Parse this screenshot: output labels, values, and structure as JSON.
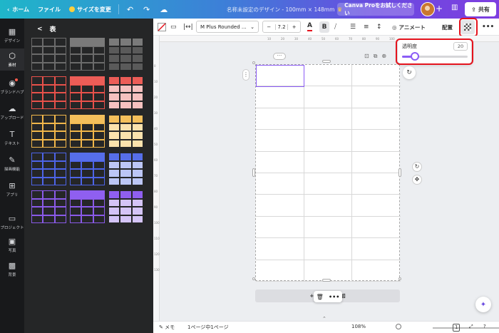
{
  "topbar": {
    "home": "ホーム",
    "file": "ファイル",
    "resize": "サイズを変更",
    "title": "名称未設定のデザイン - 100mm × 148mm",
    "pro": "Canva Proをお試しください",
    "share": "共有"
  },
  "rail": [
    {
      "label": "デザイン",
      "icon": "▦"
    },
    {
      "label": "素材",
      "icon": "⬡"
    },
    {
      "label": "ブランドハブ",
      "icon": "◉"
    },
    {
      "label": "アップロード",
      "icon": "☁"
    },
    {
      "label": "テキスト",
      "icon": "T"
    },
    {
      "label": "描画機能",
      "icon": "✎"
    },
    {
      "label": "アプリ",
      "icon": "⊞"
    },
    {
      "label": "プロジェクト",
      "icon": "▭"
    },
    {
      "label": "写真",
      "icon": "▣"
    },
    {
      "label": "背景",
      "icon": "▩"
    }
  ],
  "panel": {
    "back": "<",
    "title": "表"
  },
  "tile_colors": [
    {
      "border": "#6b6b6b",
      "header": "#7a7a7a",
      "light": "#5a5a5a"
    },
    {
      "border": "#e8514a",
      "header": "#ec5d57",
      "light": "#f6c1bf"
    },
    {
      "border": "#f2b74a",
      "header": "#f4bf5b",
      "light": "#fbe2ad"
    },
    {
      "border": "#4d64e8",
      "header": "#566ee9",
      "light": "#bcc6f6"
    },
    {
      "border": "#8a5ae8",
      "header": "#8f5ff0",
      "light": "#d4c4f7"
    }
  ],
  "toolbar": {
    "font": "M Plus Rounded ...",
    "font_size": "7.2",
    "minus": "−",
    "plus": "+",
    "bold": "B",
    "animate": "アニメート",
    "position": "配置",
    "more": "•••"
  },
  "transparency": {
    "label": "透明度",
    "value": "20",
    "level": 0.2
  },
  "canvas": {
    "add_page": "+ ページを追加"
  },
  "ruler": {
    "top": [
      "10",
      "20",
      "30",
      "40",
      "50",
      "60",
      "70",
      "80",
      "90",
      "100"
    ],
    "left": [
      "0",
      "10",
      "20",
      "30",
      "40",
      "50",
      "60",
      "70",
      "80",
      "90",
      "100",
      "110",
      "120",
      "130"
    ]
  },
  "bottombar": {
    "notes": "メモ",
    "pages": "1ページ中1ページ",
    "zoom": "108%",
    "page_count": "1"
  }
}
